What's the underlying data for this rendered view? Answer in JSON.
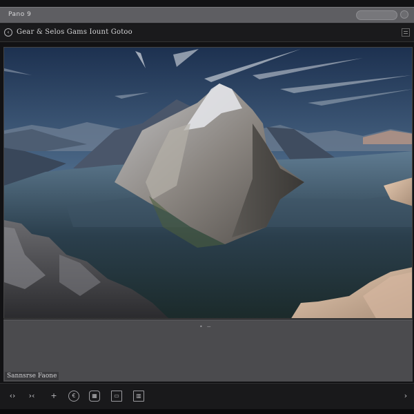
{
  "window": {
    "title": "Pano 9"
  },
  "toolbar": {
    "path_text": "Gear & Selos Gams Iount Gotoo",
    "back_icon": "back-circle-icon",
    "menu_icon": "menu-icon"
  },
  "viewer": {
    "image_description_icon": "landscape-photo"
  },
  "panel": {
    "handle_text": "• ─",
    "caption": "Sannsrse Faone"
  },
  "bottombar": {
    "tools": [
      {
        "icon": "rotate-icon",
        "glyph": "‹›"
      },
      {
        "icon": "compare-icon",
        "glyph": "›‹"
      },
      {
        "icon": "add-icon",
        "glyph": "+"
      },
      {
        "icon": "info-icon",
        "glyph": "€"
      },
      {
        "icon": "photo-icon",
        "glyph": "▦"
      },
      {
        "icon": "crop-icon",
        "glyph": "▭"
      },
      {
        "icon": "grid-icon",
        "glyph": "▥"
      }
    ],
    "next_icon": "chevron-right-icon",
    "next_glyph": "›"
  },
  "colors": {
    "titlebar": "#5e5e62",
    "toolbar": "#1a1a1c",
    "panel": "#4b4b4e",
    "bottombar": "#19191b"
  }
}
